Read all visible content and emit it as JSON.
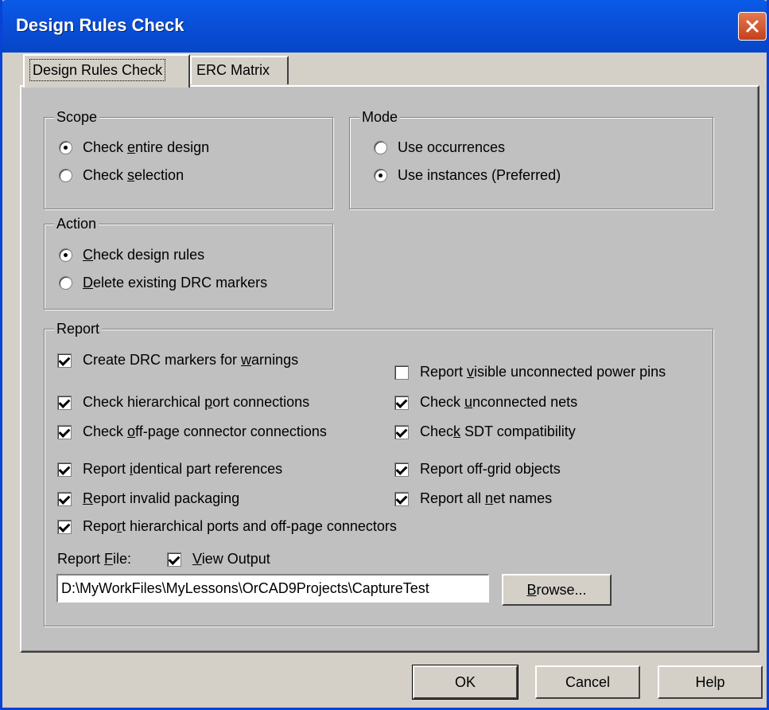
{
  "window": {
    "title": "Design Rules Check"
  },
  "tabs": [
    {
      "label": "Design Rules Check",
      "active": true
    },
    {
      "label": "ERC Matrix",
      "active": false
    }
  ],
  "scope": {
    "label": "Scope",
    "options": [
      {
        "pre": "Check ",
        "key": "e",
        "post": "ntire design",
        "selected": true
      },
      {
        "pre": "Check ",
        "key": "s",
        "post": "election",
        "selected": false
      }
    ]
  },
  "mode": {
    "label": "Mode",
    "options": [
      {
        "pre": "Use occurrences",
        "key": "",
        "post": "",
        "selected": false
      },
      {
        "pre": "Use instances (Preferred)",
        "key": "",
        "post": "",
        "selected": true
      }
    ]
  },
  "action": {
    "label": "Action",
    "options": [
      {
        "pre": "",
        "key": "C",
        "post": "heck design rules",
        "selected": true
      },
      {
        "pre": "",
        "key": "D",
        "post": "elete existing DRC markers",
        "selected": false
      }
    ]
  },
  "report": {
    "label": "Report",
    "checks": [
      {
        "pre": "Create DRC markers for ",
        "key": "w",
        "post": "arnings",
        "checked": true
      },
      {
        "pre": "Report ",
        "key": "v",
        "post": "isible unconnected power pins",
        "checked": false
      },
      {
        "pre": "Check hierarchical ",
        "key": "p",
        "post": "ort connections",
        "checked": true
      },
      {
        "pre": "Check ",
        "key": "u",
        "post": "nconnected nets",
        "checked": true
      },
      {
        "pre": "Check ",
        "key": "o",
        "post": "ff-page connector connections",
        "checked": true
      },
      {
        "pre": "Chec",
        "key": "k",
        "post": " SDT compatibility",
        "checked": true
      },
      {
        "pre": "Report ",
        "key": "i",
        "post": "dentical part references",
        "checked": true
      },
      {
        "pre": "Report off-",
        "key": "g",
        "post": "rid objects",
        "checked": true
      },
      {
        "pre": "",
        "key": "R",
        "post": "eport invalid packaging",
        "checked": true
      },
      {
        "pre": "Report all ",
        "key": "n",
        "post": "et names",
        "checked": true
      },
      {
        "pre": "Repo",
        "key": "r",
        "post": "t hierarchical ports and off-page connectors",
        "checked": true
      }
    ],
    "file_label_pre": "Report ",
    "file_label_key": "F",
    "file_label_post": "ile:",
    "view_output": {
      "pre": "",
      "key": "V",
      "post": "iew Output",
      "checked": true
    },
    "file_path": "D:\\MyWorkFiles\\MyLessons\\OrCAD9Projects\\CaptureTest",
    "browse": {
      "pre": "",
      "key": "B",
      "post": "rowse..."
    }
  },
  "buttons": {
    "ok": "OK",
    "cancel": "Cancel",
    "help": "Help"
  }
}
